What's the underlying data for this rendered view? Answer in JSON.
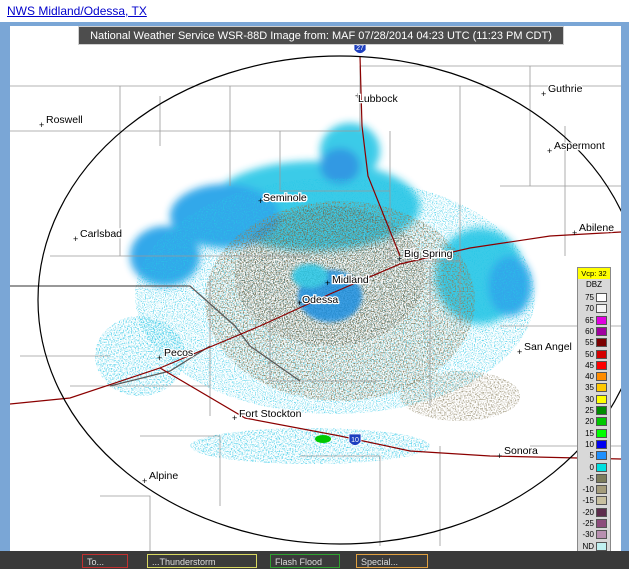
{
  "header": {
    "link_text": "NWS Midland/Odessa, TX"
  },
  "map": {
    "banner_text": "National Weather Service WSR-88D Image from: MAF 07/28/2014 04:23 UTC (11:23 PM CDT)",
    "cities": [
      {
        "id": "lubbock",
        "name": "Lubbock"
      },
      {
        "id": "guthrie",
        "name": "Guthrie"
      },
      {
        "id": "roswell",
        "name": "Roswell"
      },
      {
        "id": "aspermont",
        "name": "Aspermont"
      },
      {
        "id": "seminole",
        "name": "Seminole"
      },
      {
        "id": "carlsbad",
        "name": "Carlsbad"
      },
      {
        "id": "abilene",
        "name": "Abilene"
      },
      {
        "id": "big_spring",
        "name": "Big Spring"
      },
      {
        "id": "midland",
        "name": "Midland"
      },
      {
        "id": "odessa",
        "name": "Odessa"
      },
      {
        "id": "pecos",
        "name": "Pecos"
      },
      {
        "id": "san_angelo",
        "name": "San Angel"
      },
      {
        "id": "fort_stockton",
        "name": "Fort Stockton"
      },
      {
        "id": "sonora",
        "name": "Sonora"
      },
      {
        "id": "alpine",
        "name": "Alpine"
      }
    ],
    "interstates": [
      {
        "id": "i27",
        "number": "27",
        "color": "#1e3fbf"
      },
      {
        "id": "i10",
        "number": "10",
        "color": "#1e3fbf"
      }
    ]
  },
  "legend": {
    "vcp": "Vcp: 32",
    "unit": "DBZ",
    "rows": [
      {
        "value": "75",
        "color": "#ffffff"
      },
      {
        "value": "70",
        "color": "#f5f5f5"
      },
      {
        "value": "65",
        "color": "#e000e0"
      },
      {
        "value": "60",
        "color": "#a000a0"
      },
      {
        "value": "55",
        "color": "#7a0000"
      },
      {
        "value": "50",
        "color": "#d40000"
      },
      {
        "value": "45",
        "color": "#ff0000"
      },
      {
        "value": "40",
        "color": "#ff8c00"
      },
      {
        "value": "35",
        "color": "#ffc800"
      },
      {
        "value": "30",
        "color": "#ffff00"
      },
      {
        "value": "25",
        "color": "#008c00"
      },
      {
        "value": "20",
        "color": "#00c800"
      },
      {
        "value": "15",
        "color": "#00ff00"
      },
      {
        "value": "10",
        "color": "#0000f0"
      },
      {
        "value": "5",
        "color": "#1e90ff"
      },
      {
        "value": "0",
        "color": "#00e0e0"
      },
      {
        "value": "-5",
        "color": "#7c7c5c"
      },
      {
        "value": "-10",
        "color": "#a49c7c"
      },
      {
        "value": "-15",
        "color": "#c8c0a0"
      },
      {
        "value": "-20",
        "color": "#5c2c4c"
      },
      {
        "value": "-25",
        "color": "#8c4c7c"
      },
      {
        "value": "-30",
        "color": "#b890b0"
      },
      {
        "value": "ND",
        "color": "#c0f0f0"
      }
    ]
  },
  "bottom_buttons": [
    {
      "id": "btn1",
      "label": "To...",
      "color": "#c03030"
    },
    {
      "id": "btn2",
      "label": "...Thunderstorm",
      "color": "#d8d860"
    },
    {
      "id": "btn3",
      "label": "Flash Flood",
      "color": "#30a030"
    },
    {
      "id": "btn4",
      "label": "Special...",
      "color": "#e0a040"
    }
  ],
  "colors": {
    "frame": "#7aa6d6",
    "echo_cyan": "#27c6e6",
    "echo_blue": "#1e8fe0",
    "echo_khaki": "#8a8060",
    "echo_olive": "#5b5a48",
    "road": "#8b0000",
    "boundary": "#9a9a9a"
  }
}
